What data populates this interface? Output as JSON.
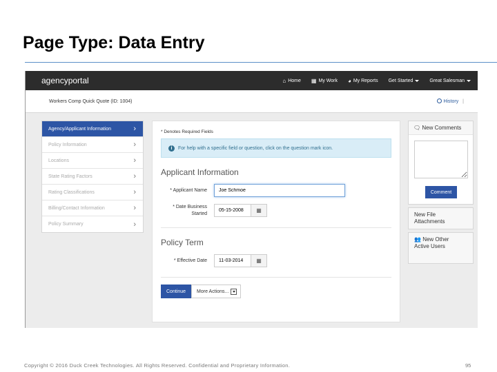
{
  "slide": {
    "title": "Page Type: Data Entry",
    "footer": "Copyright © 2016 Duck Creek Technologies. All Rights Reserved. Confidential and Proprietary Information.",
    "page_number": "95",
    "accent_color": "#5b8fc7"
  },
  "navbar": {
    "brand": "agencyportal",
    "items": [
      {
        "label": "Home",
        "icon": "home-icon"
      },
      {
        "label": "My Work",
        "icon": "grid-icon"
      },
      {
        "label": "My Reports",
        "icon": "pie-chart-icon"
      },
      {
        "label": "Get Started",
        "icon": "dropdown-caret"
      },
      {
        "label": "Great Salesman",
        "icon": "dropdown-caret"
      }
    ]
  },
  "subheader": {
    "quote_title": "Workers Comp Quick Quote (ID: 1004)",
    "history_label": "History",
    "history_sep": "|"
  },
  "sidebar": {
    "items": [
      {
        "label": "Agency/Applicant Information",
        "active": true
      },
      {
        "label": "Policy Information",
        "active": false
      },
      {
        "label": "Locations",
        "active": false
      },
      {
        "label": "State Rating Factors",
        "active": false
      },
      {
        "label": "Rating Classifications",
        "active": false
      },
      {
        "label": "Billing/Contact Information",
        "active": false
      },
      {
        "label": "Policy Summary",
        "active": false
      }
    ],
    "chevron": "›"
  },
  "form": {
    "required_note": "* Denotes Required Fields",
    "help_text": "For help with a specific field or question, click on the question mark icon.",
    "applicant_section": "Applicant Information",
    "applicant_name_label": "* Applicant Name",
    "applicant_name_value": "Joe Schmoe",
    "date_business_label_1": "* Date Business",
    "date_business_label_2": "Started",
    "date_business_value": "05-15-2008",
    "policy_section": "Policy Term",
    "effective_date_label": "* Effective Date",
    "effective_date_value": "11-03-2014",
    "continue_label": "Continue",
    "more_actions_label": "More Actions..."
  },
  "right_panel": {
    "new_comments": "New Comments",
    "comment_button": "Comment",
    "new_file_attachments_1": "New File",
    "new_file_attachments_2": "Attachments",
    "new_other_users_1": "New Other",
    "new_other_users_2": "Active Users"
  },
  "colors": {
    "primary": "#2d55a5",
    "navbar": "#2c2c2c",
    "info_bg": "#d9edf7"
  }
}
